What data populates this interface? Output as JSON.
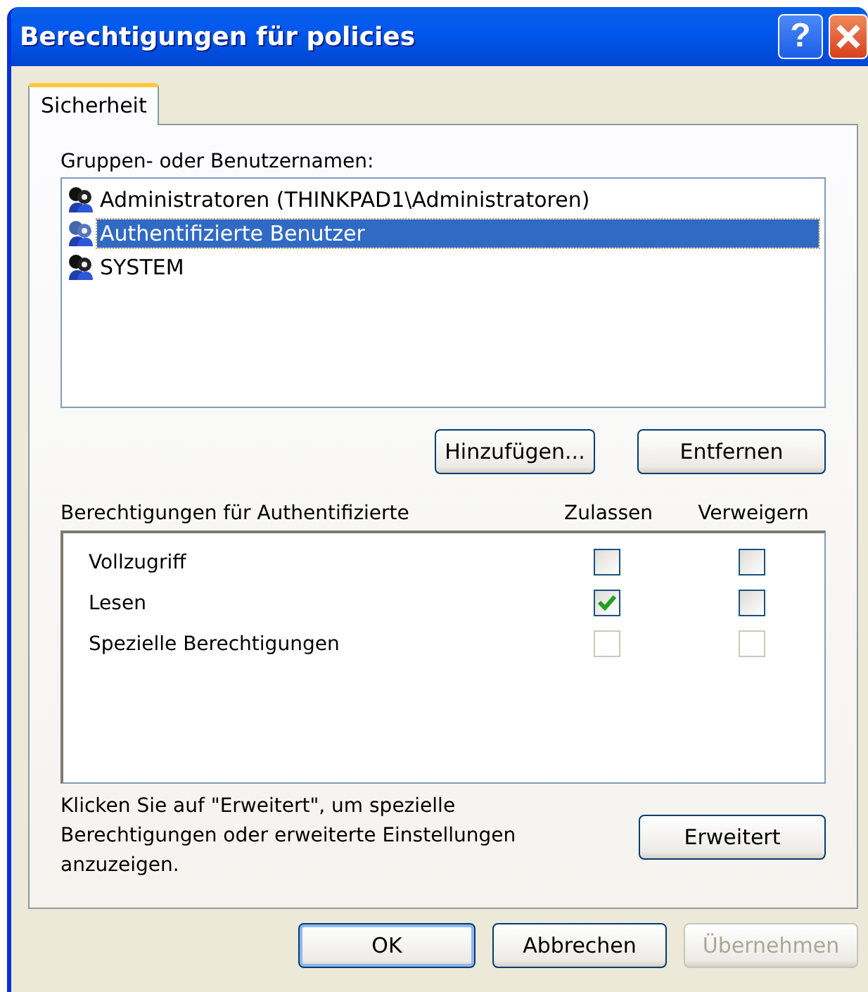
{
  "window": {
    "title": "Berechtigungen für policies",
    "help_button": "?"
  },
  "tabs": [
    {
      "label": "Sicherheit",
      "selected": true
    }
  ],
  "groups": {
    "label": "Gruppen- oder Benutzernamen:",
    "items": [
      {
        "name": "Administratoren (THINKPAD1\\Administratoren)",
        "selected": false
      },
      {
        "name": "Authentifizierte Benutzer",
        "selected": true
      },
      {
        "name": "SYSTEM",
        "selected": false
      }
    ],
    "buttons": [
      {
        "label": "Hinzufügen...",
        "disabled": false
      },
      {
        "label": "Entfernen",
        "disabled": false
      }
    ]
  },
  "permissions": {
    "label": "Berechtigungen für Authentifizierte",
    "columns": [
      "Zulassen",
      "Verweigern"
    ],
    "rows": [
      {
        "name": "Vollzugriff",
        "allow": {
          "checked": false,
          "disabled": false
        },
        "deny": {
          "checked": false,
          "disabled": false
        }
      },
      {
        "name": "Lesen",
        "allow": {
          "checked": true,
          "disabled": false
        },
        "deny": {
          "checked": false,
          "disabled": false
        }
      },
      {
        "name": "Spezielle Berechtigungen",
        "allow": {
          "checked": false,
          "disabled": true
        },
        "deny": {
          "checked": false,
          "disabled": true
        }
      }
    ]
  },
  "advanced": {
    "text": "Klicken Sie auf \"Erweitert\", um spezielle Berechtigungen oder erweiterte Einstellungen anzuzeigen.",
    "button": {
      "label": "Erweitert",
      "disabled": false
    }
  },
  "buttons": [
    {
      "label": "OK",
      "disabled": false,
      "default": true
    },
    {
      "label": "Abbrechen",
      "disabled": false,
      "default": false
    },
    {
      "label": "Übernehmen",
      "disabled": true,
      "default": false
    }
  ]
}
